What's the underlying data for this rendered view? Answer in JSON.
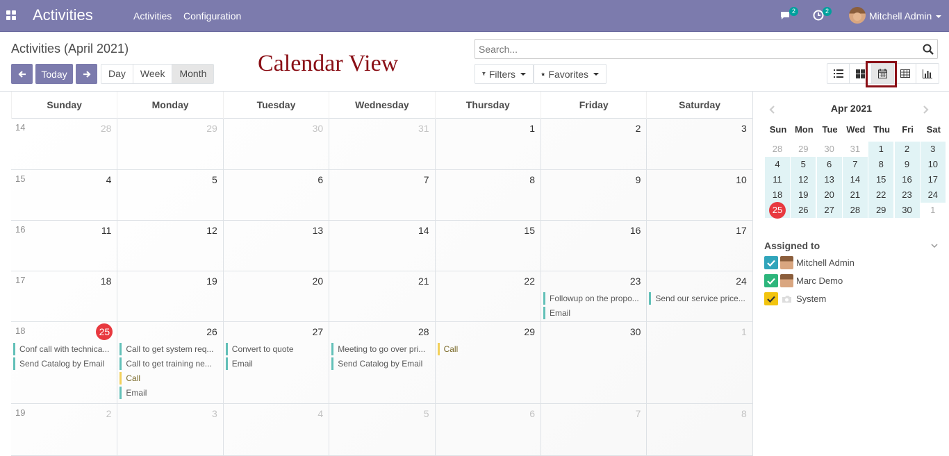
{
  "navbar": {
    "brand": "Activities",
    "menu": [
      "Activities",
      "Configuration"
    ],
    "messages_badge": "2",
    "activities_badge": "2",
    "user": "Mitchell Admin",
    "color": "#7c7bad"
  },
  "control_panel": {
    "breadcrumb": "Activities (April 2021)",
    "today_label": "Today",
    "scale_buttons": [
      "Day",
      "Week",
      "Month"
    ],
    "active_scale": "Month",
    "annotation": "Calendar View",
    "search_placeholder": "Search...",
    "filters_label": "Filters",
    "favorites_label": "Favorites",
    "views": [
      "list-icon",
      "kanban-icon",
      "calendar-icon",
      "pivot-icon",
      "graph-icon"
    ],
    "active_view": "calendar-icon"
  },
  "calendar": {
    "weekdays": [
      "Sunday",
      "Monday",
      "Tuesday",
      "Wednesday",
      "Thursday",
      "Friday",
      "Saturday"
    ],
    "weeks": [
      {
        "num": "14",
        "days": [
          "28",
          "29",
          "30",
          "31",
          "1",
          "2",
          "3"
        ]
      },
      {
        "num": "15",
        "days": [
          "4",
          "5",
          "6",
          "7",
          "8",
          "9",
          "10"
        ]
      },
      {
        "num": "16",
        "days": [
          "11",
          "12",
          "13",
          "14",
          "15",
          "16",
          "17"
        ]
      },
      {
        "num": "17",
        "days": [
          "18",
          "19",
          "20",
          "21",
          "22",
          "23",
          "24"
        ]
      },
      {
        "num": "18",
        "days": [
          "25",
          "26",
          "27",
          "28",
          "29",
          "30",
          "1"
        ]
      },
      {
        "num": "19",
        "days": [
          "2",
          "3",
          "4",
          "5",
          "6",
          "7",
          "8"
        ]
      }
    ],
    "events": {
      "w3d5": [
        "Followup on the propo...",
        "Email"
      ],
      "w3d6": [
        "Send our service price..."
      ],
      "w4d0": [
        "Conf call with technica...",
        "Send Catalog by Email"
      ],
      "w4d1": [
        "Call to get system req...",
        "Call to get training ne...",
        "Call",
        "Email"
      ],
      "w4d2": [
        "Convert to quote",
        "Email"
      ],
      "w4d3": [
        "Meeting to go over pri...",
        "Send Catalog by Email"
      ],
      "w4d4": [
        "Call"
      ]
    }
  },
  "sidebar": {
    "month_title": "Apr 2021",
    "mini_dow": [
      "Sun",
      "Mon",
      "Tue",
      "Wed",
      "Thu",
      "Fri",
      "Sat"
    ],
    "mini_weeks": [
      [
        "28",
        "29",
        "30",
        "31",
        "1",
        "2",
        "3"
      ],
      [
        "4",
        "5",
        "6",
        "7",
        "8",
        "9",
        "10"
      ],
      [
        "11",
        "12",
        "13",
        "14",
        "15",
        "16",
        "17"
      ],
      [
        "18",
        "19",
        "20",
        "21",
        "22",
        "23",
        "24"
      ],
      [
        "25",
        "26",
        "27",
        "28",
        "29",
        "30",
        "1"
      ]
    ],
    "assigned_title": "Assigned to",
    "attendees": [
      {
        "name": "Mitchell Admin",
        "color": "#31a5bb"
      },
      {
        "name": "Marc Demo",
        "color": "#2db67c"
      },
      {
        "name": "System",
        "color": "#f2c40f"
      }
    ]
  }
}
